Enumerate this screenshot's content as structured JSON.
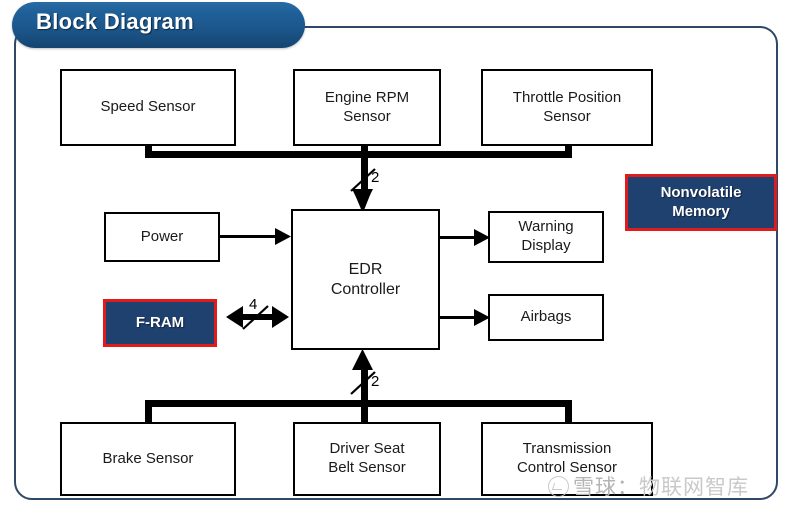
{
  "title": {
    "label": "Block Diagram"
  },
  "colors": {
    "title_tab_blue": "#1d5a91",
    "frame_border": "#2e4866",
    "highlight_fill": "#1f4170",
    "highlight_border": "#e01b1b",
    "box_border": "#000000",
    "wire": "#000000",
    "watermark": "#c9c9c9"
  },
  "blocks": {
    "top_sensors": [
      {
        "id": "speed-sensor",
        "label": "Speed Sensor"
      },
      {
        "id": "engine-rpm-sensor",
        "label": "Engine RPM\nSensor"
      },
      {
        "id": "throttle-position-sensor",
        "label": "Throttle Position\nSensor"
      }
    ],
    "bottom_sensors": [
      {
        "id": "brake-sensor",
        "label": "Brake Sensor"
      },
      {
        "id": "driver-seat-belt-sensor",
        "label": "Driver Seat\nBelt Sensor"
      },
      {
        "id": "transmission-control-sensor",
        "label": "Transmission\nControl Sensor"
      }
    ],
    "power": {
      "id": "power",
      "label": "Power"
    },
    "controller": {
      "id": "edr-controller",
      "label": "EDR\nController"
    },
    "outputs": [
      {
        "id": "warning-display",
        "label": "Warning\nDisplay"
      },
      {
        "id": "airbags",
        "label": "Airbags"
      }
    ],
    "highlights": [
      {
        "id": "nonvolatile-memory",
        "label": "Nonvolatile\nMemory"
      },
      {
        "id": "f-ram",
        "label": "F-RAM"
      }
    ]
  },
  "bus_labels": {
    "top_bus_width": "2",
    "bottom_bus_width": "2",
    "fram_bus_width": "4"
  },
  "watermark": {
    "prefix": "雪球：",
    "suffix": "物联网智库"
  }
}
